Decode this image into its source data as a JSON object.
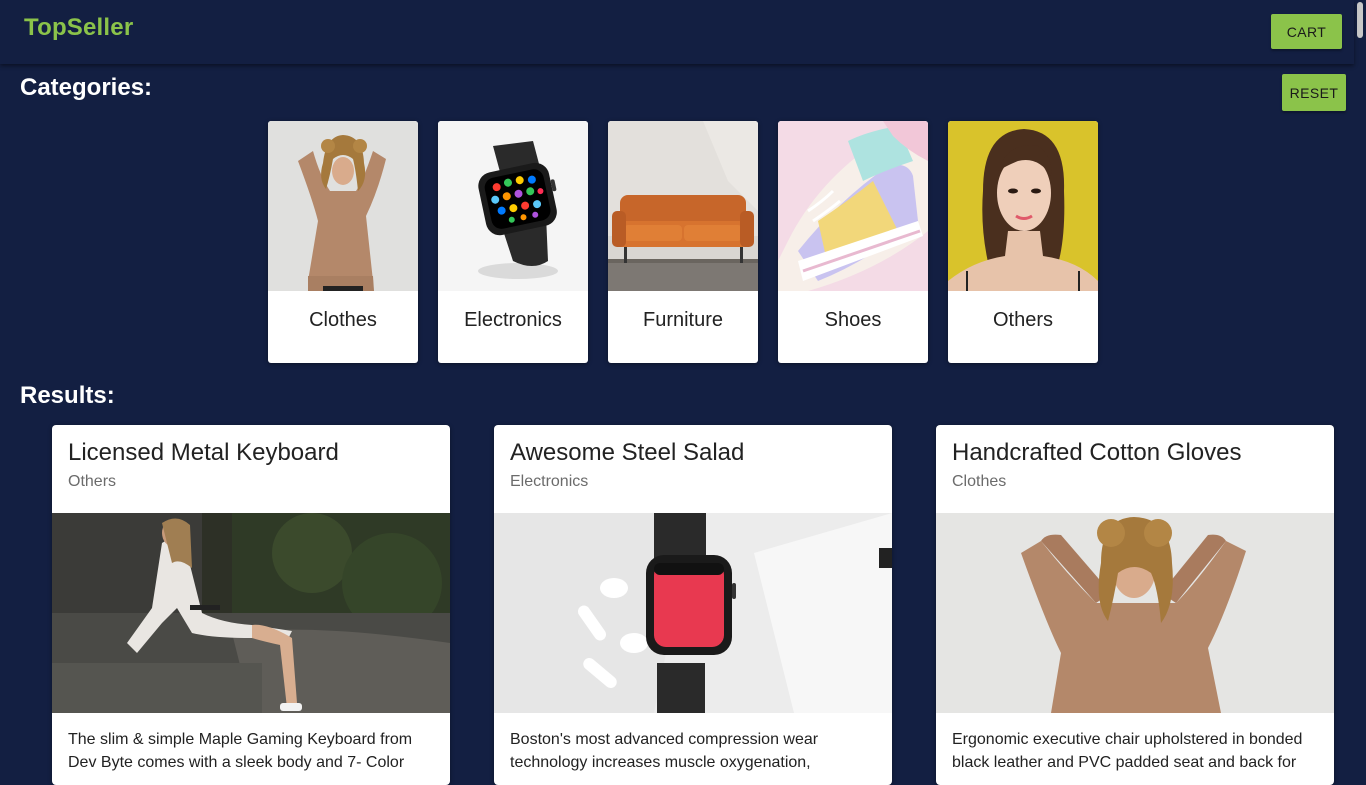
{
  "header": {
    "brand": "TopSeller",
    "cart_label": "CART"
  },
  "categories": {
    "title": "Categories:",
    "reset_label": "RESET",
    "items": [
      {
        "label": "Clothes"
      },
      {
        "label": "Electronics"
      },
      {
        "label": "Furniture"
      },
      {
        "label": "Shoes"
      },
      {
        "label": "Others"
      }
    ]
  },
  "results": {
    "title": "Results:",
    "items": [
      {
        "name": "Licensed Metal Keyboard",
        "category": "Others",
        "description": "The slim & simple Maple Gaming Keyboard from Dev Byte comes with a sleek body and 7- Color"
      },
      {
        "name": "Awesome Steel Salad",
        "category": "Electronics",
        "description": "Boston's most advanced compression wear technology increases muscle oxygenation,"
      },
      {
        "name": "Handcrafted Cotton Gloves",
        "category": "Clothes",
        "description": "Ergonomic executive chair upholstered in bonded black leather and PVC padded seat and back for"
      }
    ]
  },
  "colors": {
    "background": "#131f42",
    "accent": "#8bc34a",
    "card": "#ffffff"
  }
}
